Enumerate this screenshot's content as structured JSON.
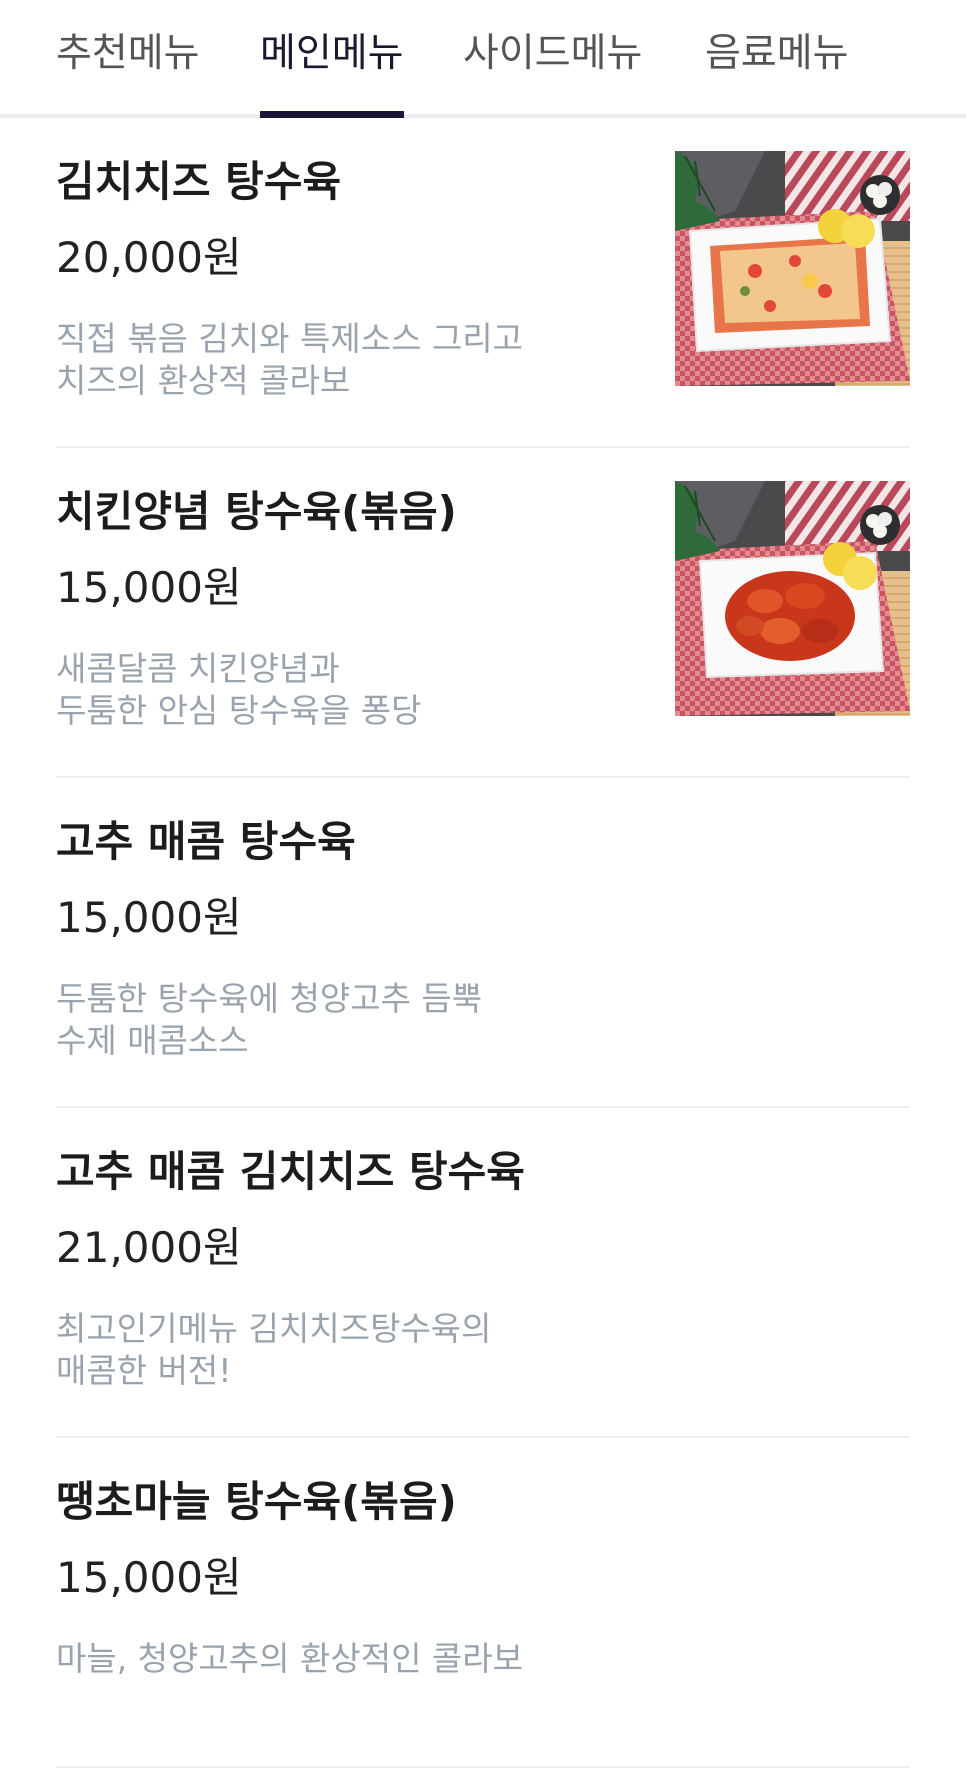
{
  "tabs": [
    {
      "label": "추천메뉴",
      "active": false
    },
    {
      "label": "메인메뉴",
      "active": true
    },
    {
      "label": "사이드메뉴",
      "active": false
    },
    {
      "label": "음료메뉴",
      "active": false
    }
  ],
  "menu_items": [
    {
      "name": "김치치즈 탕수육",
      "price": "20,000원",
      "description": "직접 볶음 김치와 특제소스 그리고\n치즈의 환상적 콜라보",
      "image": "kimchi-cheese-tangsuyuk-photo"
    },
    {
      "name": "치킨양념 탕수육(볶음)",
      "price": "15,000원",
      "description": "새콤달콤 치킨양념과\n두툼한 안심 탕수육을 퐁당",
      "image": "chicken-sauce-tangsuyuk-photo"
    },
    {
      "name": "고추 매콤 탕수육",
      "price": "15,000원",
      "description": "두툼한 탕수육에 청양고추 듬뿍\n수제 매콤소스",
      "image": null
    },
    {
      "name": "고추 매콤 김치치즈 탕수육",
      "price": "21,000원",
      "description": "최고인기메뉴 김치치즈탕수육의\n매콤한 버전!",
      "image": null
    },
    {
      "name": "땡초마늘 탕수육(볶음)",
      "price": "15,000원",
      "description": "마늘, 청양고추의 환상적인 콜라보",
      "image": null
    }
  ],
  "colors": {
    "tab_indicator": "#19163a",
    "description_text": "#9aa3ad",
    "divider": "#efeff2"
  }
}
